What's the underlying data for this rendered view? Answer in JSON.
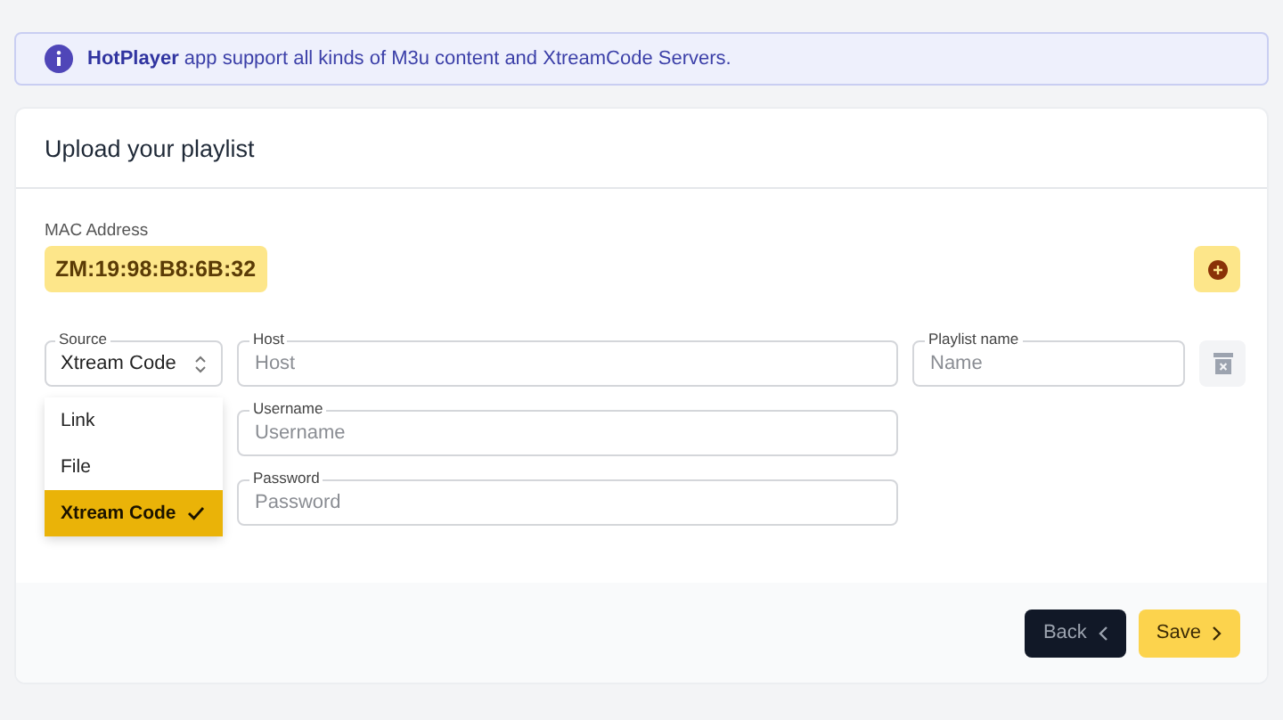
{
  "banner": {
    "text": "**HotPlayer** app support all kinds of M3u content and XtreamCode Servers."
  },
  "card": {
    "title": "Upload your playlist"
  },
  "mac": {
    "label": "MAC Address",
    "value": "ZM:19:98:B8:6B:32"
  },
  "source": {
    "label": "Source",
    "value": "Xtream Code",
    "expanded": true,
    "options": [
      {
        "label": "Link",
        "selected": false
      },
      {
        "label": "File",
        "selected": false
      },
      {
        "label": "Xtream Code",
        "selected": true
      }
    ]
  },
  "fields": [
    {
      "kind": "host",
      "label": "Host",
      "placeholder": "Host"
    },
    {
      "kind": "username",
      "label": "Username",
      "placeholder": "Username"
    },
    {
      "kind": "password",
      "label": "Password",
      "placeholder": "Password"
    },
    {
      "kind": "playlist",
      "label": "Playlist name",
      "placeholder": "Name"
    }
  ],
  "buttons": [
    {
      "kind": "back",
      "label": "Back"
    },
    {
      "kind": "save",
      "label": "Save"
    }
  ]
}
